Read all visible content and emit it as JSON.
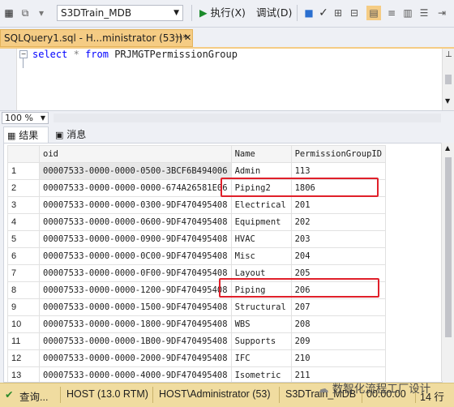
{
  "toolbar": {
    "database": "S3DTrain_MDB",
    "execute_label": "执行(X)",
    "debug_label": "调试(D)"
  },
  "tab": {
    "title": "SQLQuery1.sql - H...ministrator (53))*",
    "pin_icon": "pin-icon",
    "close_icon": "close-icon"
  },
  "editor": {
    "keyword_select": "select",
    "star": "*",
    "keyword_from": "from",
    "table_name": "PRJMGTPermissionGroup"
  },
  "zoom": {
    "value": "100 %"
  },
  "result_tabs": {
    "results": "结果",
    "messages": "消息"
  },
  "grid": {
    "columns": [
      "oid",
      "Name",
      "PermissionGroupID"
    ],
    "rows": [
      {
        "n": "1",
        "oid": "00007533-0000-0000-0500-3BCF6B494006",
        "name": "Admin",
        "id": "113"
      },
      {
        "n": "2",
        "oid": "00007533-0000-0000-0000-674A26581E06",
        "name": "Piping2",
        "id": "1806"
      },
      {
        "n": "3",
        "oid": "00007533-0000-0000-0300-9DF470495408",
        "name": "Electrical",
        "id": "201"
      },
      {
        "n": "4",
        "oid": "00007533-0000-0000-0600-9DF470495408",
        "name": "Equipment",
        "id": "202"
      },
      {
        "n": "5",
        "oid": "00007533-0000-0000-0900-9DF470495408",
        "name": "HVAC",
        "id": "203"
      },
      {
        "n": "6",
        "oid": "00007533-0000-0000-0C00-9DF470495408",
        "name": "Misc",
        "id": "204"
      },
      {
        "n": "7",
        "oid": "00007533-0000-0000-0F00-9DF470495408",
        "name": "Layout",
        "id": "205"
      },
      {
        "n": "8",
        "oid": "00007533-0000-0000-1200-9DF470495408",
        "name": "Piping",
        "id": "206"
      },
      {
        "n": "9",
        "oid": "00007533-0000-0000-1500-9DF470495408",
        "name": "Structural",
        "id": "207"
      },
      {
        "n": "10",
        "oid": "00007533-0000-0000-1800-9DF470495408",
        "name": "WBS",
        "id": "208"
      },
      {
        "n": "11",
        "oid": "00007533-0000-0000-1B00-9DF470495408",
        "name": "Supports",
        "id": "209"
      },
      {
        "n": "12",
        "oid": "00007533-0000-0000-2000-9DF470495408",
        "name": "IFC",
        "id": "210"
      },
      {
        "n": "13",
        "oid": "00007533-0000-0000-4000-9DF470495408",
        "name": "Isometric",
        "id": "211"
      }
    ]
  },
  "status": {
    "query": "查询...",
    "host": "HOST (13.0 RTM)",
    "user": "HOST\\Administrator (53)",
    "db": "S3DTrain_MDB",
    "time": "00:00:00",
    "rows": "14 行"
  },
  "watermark": "数智化流程工厂设计",
  "highlight_color": "#e0202a",
  "tab_color": "#f5cc84",
  "status_color": "#f0dca0"
}
